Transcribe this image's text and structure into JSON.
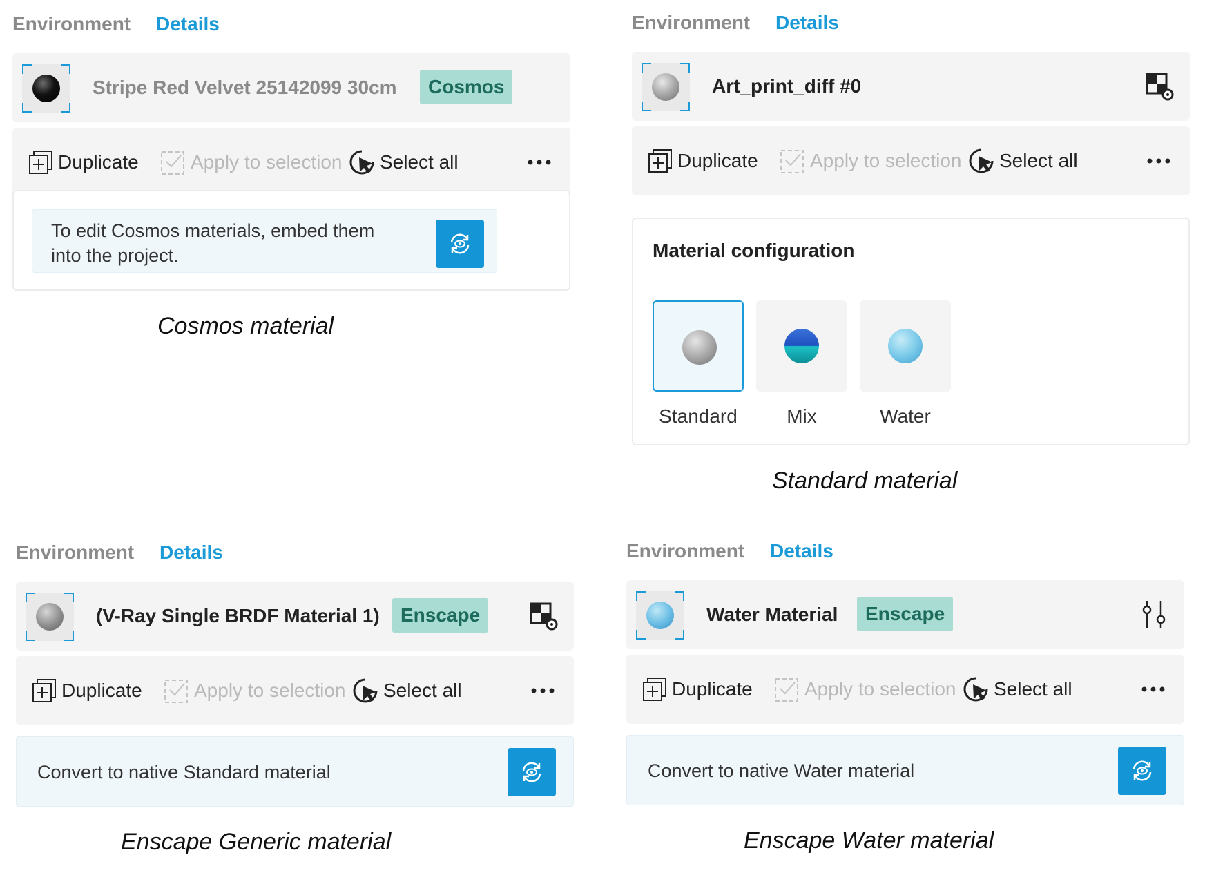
{
  "panels": {
    "cosmos": {
      "tabs": {
        "environment": "Environment",
        "details": "Details"
      },
      "material_name": "Stripe Red Velvet 25142099 30cm",
      "badge": "Cosmos",
      "toolbar": {
        "duplicate": "Duplicate",
        "apply": "Apply to selection",
        "select_all": "Select all"
      },
      "info_text": "To edit Cosmos materials, embed them into the project.",
      "caption": "Cosmos material"
    },
    "standard": {
      "tabs": {
        "environment": "Environment",
        "details": "Details"
      },
      "material_name": "Art_print_diff #0",
      "toolbar": {
        "duplicate": "Duplicate",
        "apply": "Apply to selection",
        "select_all": "Select all"
      },
      "config_title": "Material configuration",
      "options": [
        "Standard",
        "Mix",
        "Water"
      ],
      "selected_option": "Standard",
      "caption": "Standard material"
    },
    "generic": {
      "tabs": {
        "environment": "Environment",
        "details": "Details"
      },
      "material_name": "(V-Ray Single BRDF Material 1)",
      "badge": "Enscape",
      "toolbar": {
        "duplicate": "Duplicate",
        "apply": "Apply to selection",
        "select_all": "Select all"
      },
      "info_text": "Convert to native Standard material",
      "caption": "Enscape Generic material"
    },
    "water": {
      "tabs": {
        "environment": "Environment",
        "details": "Details"
      },
      "material_name": "Water Material",
      "badge": "Enscape",
      "toolbar": {
        "duplicate": "Duplicate",
        "apply": "Apply to selection",
        "select_all": "Select all"
      },
      "info_text": "Convert to native Water material",
      "caption": "Enscape Water material"
    }
  },
  "icons": {
    "duplicate": "duplicate-icon",
    "apply": "apply-to-selection-icon",
    "select_all": "select-all-cursor-icon",
    "more": "more-dots-icon",
    "convert": "convert-refresh-icon",
    "material_settings": "material-settings-icon",
    "adjust": "sliders-icon"
  },
  "colors": {
    "accent": "#1a9ad6",
    "badge_bg": "#a9ddd3",
    "badge_text": "#1d6b5c",
    "convert_button": "#1496d6"
  }
}
